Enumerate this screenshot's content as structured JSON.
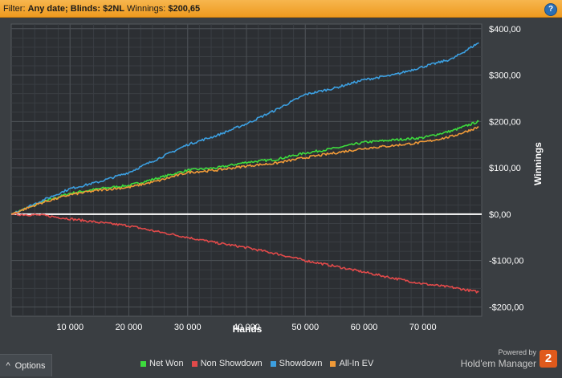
{
  "filter": {
    "prefix": "Filter:",
    "date": "Any date;",
    "blinds": "Blinds: $2NL",
    "winnings_label": "Winnings:",
    "winnings_value": "$200,65"
  },
  "help_icon": "question-mark",
  "options": {
    "arrow": "^",
    "label": "Options"
  },
  "brand": {
    "powered": "Powered by",
    "name": "Hold'em Manager",
    "logo": "2"
  },
  "chart_data": {
    "type": "line",
    "xlabel": "Hands",
    "ylabel": "Winnings",
    "xlim": [
      0,
      80000
    ],
    "ylim": [
      -220,
      410
    ],
    "x_ticks": [
      10000,
      20000,
      30000,
      40000,
      50000,
      60000,
      70000
    ],
    "x_tick_labels": [
      "10 000",
      "20 000",
      "30 000",
      "40 000",
      "50 000",
      "60 000",
      "70 000"
    ],
    "y_ticks": [
      400,
      300,
      200,
      100,
      0,
      -100,
      -200
    ],
    "y_tick_labels": [
      "$400,00",
      "$300,00",
      "$200,00",
      "$100,00",
      "$0,00",
      "-$100,00",
      "-$200,00"
    ],
    "grid": true,
    "legend_position": "bottom",
    "series": [
      {
        "name": "Net Won",
        "color": "#3ddc3d",
        "x": [
          0,
          5000,
          10000,
          15000,
          20000,
          25000,
          30000,
          35000,
          40000,
          45000,
          50000,
          55000,
          60000,
          65000,
          70000,
          75000,
          79500
        ],
        "values": [
          0,
          25,
          45,
          55,
          62,
          78,
          95,
          100,
          112,
          118,
          132,
          142,
          155,
          160,
          165,
          180,
          200
        ]
      },
      {
        "name": "Non Showdown",
        "color": "#e24a4a",
        "x": [
          0,
          5000,
          10000,
          15000,
          20000,
          25000,
          30000,
          35000,
          40000,
          45000,
          50000,
          55000,
          60000,
          65000,
          70000,
          75000,
          79500
        ],
        "values": [
          0,
          -2,
          -10,
          -18,
          -25,
          -38,
          -50,
          -62,
          -72,
          -85,
          -100,
          -112,
          -125,
          -138,
          -150,
          -158,
          -168
        ]
      },
      {
        "name": "Showdown",
        "color": "#3c9fe0",
        "x": [
          0,
          5000,
          10000,
          15000,
          20000,
          25000,
          30000,
          35000,
          40000,
          45000,
          50000,
          55000,
          60000,
          65000,
          70000,
          75000,
          79500
        ],
        "values": [
          0,
          28,
          55,
          70,
          90,
          120,
          150,
          170,
          195,
          225,
          258,
          272,
          290,
          300,
          318,
          335,
          370
        ]
      },
      {
        "name": "All-In EV",
        "color": "#f09a38",
        "x": [
          0,
          5000,
          10000,
          15000,
          20000,
          25000,
          30000,
          35000,
          40000,
          45000,
          50000,
          55000,
          60000,
          65000,
          70000,
          75000,
          79500
        ],
        "values": [
          0,
          24,
          42,
          52,
          58,
          72,
          90,
          95,
          104,
          110,
          122,
          132,
          142,
          148,
          155,
          168,
          188
        ]
      }
    ]
  }
}
